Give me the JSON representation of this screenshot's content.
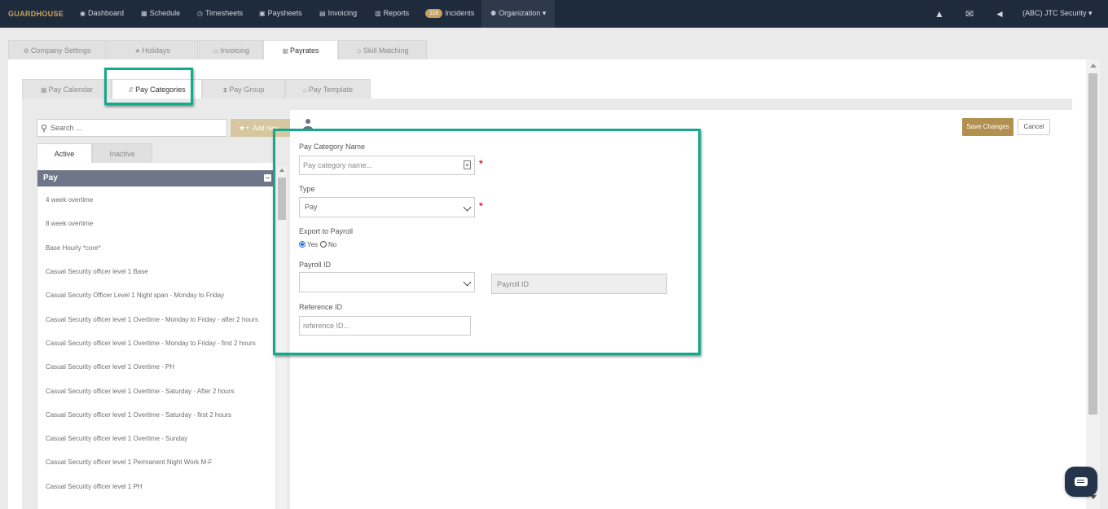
{
  "topnav": {
    "logo": "GUARDHOUSE",
    "items": [
      {
        "label": "Dashboard",
        "icon": "dashboard-icon",
        "glyph": "◉"
      },
      {
        "label": "Schedule",
        "icon": "calendar-icon",
        "glyph": "▦"
      },
      {
        "label": "Timesheets",
        "icon": "clock-icon",
        "glyph": "◷"
      },
      {
        "label": "Paysheets",
        "icon": "money-icon",
        "glyph": "▣"
      },
      {
        "label": "Invoicing",
        "icon": "invoice-icon",
        "glyph": "▤"
      },
      {
        "label": "Reports",
        "icon": "table-icon",
        "glyph": "▥"
      },
      {
        "label": "Incidents",
        "badge": "118"
      },
      {
        "label": "Organization",
        "icon": "users-icon",
        "glyph": "⚉",
        "caret": "▾"
      }
    ],
    "account": "(ABC) JTC Security",
    "account_caret": "▾",
    "right_icons": [
      {
        "name": "graduation-cap-icon",
        "glyph": "▲"
      },
      {
        "name": "envelope-icon",
        "glyph": "✉"
      },
      {
        "name": "megaphone-icon",
        "glyph": "◄"
      }
    ]
  },
  "top_tabs": [
    {
      "label": "Company Settings",
      "icon": "gear-icon",
      "glyph": "⚙"
    },
    {
      "label": "Holidays",
      "icon": "star-icon",
      "glyph": "★"
    },
    {
      "label": "Invoicing",
      "icon": "invoice-icon",
      "glyph": "▭"
    },
    {
      "label": "Payrates",
      "icon": "calendar-icon",
      "glyph": "▦",
      "active": true
    },
    {
      "label": "Skill Matching",
      "icon": "diamond-icon",
      "glyph": "◇"
    }
  ],
  "sub_tabs": [
    {
      "label": "Pay Calendar",
      "icon": "calendar-icon",
      "glyph": "▦"
    },
    {
      "label": "Pay Categories",
      "icon": "sort-icon",
      "glyph": "⇵",
      "active": true
    },
    {
      "label": "Pay Group",
      "icon": "hourglass-icon",
      "glyph": "⧗"
    },
    {
      "label": "Pay Template",
      "icon": "bank-icon",
      "glyph": "⌂"
    }
  ],
  "left": {
    "search_placeholder": "Search ...",
    "add_new_label": "Add new",
    "status_tabs": {
      "active": "Active",
      "inactive": "Inactive"
    },
    "group_title": "Pay",
    "items": [
      "4 week overtime",
      "8 week overtime",
      "Base Hourly *core*",
      "Casual Security officer level 1 Base",
      "Casual Security Officer Level 1 Night span - Monday to Friday",
      "Casual Security officer level 1 Overtime - Monday to Friday - after 2 hours",
      "Casual Security officer level 1 Overtime - Monday to Friday - first 2 hours",
      "Casual Security officer level 1 Overtime - PH",
      "Casual Security officer level 1 Overtime - Saturday - After 2 hours",
      "Casual Security officer level 1 Overtime - Saturday - first 2 hours",
      "Casual Security officer level 1 Overtime - Sunday",
      "Casual Security officer level 1 Permanent Night Work M-F",
      "Casual Security officer level 1 PH"
    ]
  },
  "form": {
    "save_label": "Save Changes",
    "cancel_label": "Cancel",
    "name_label": "Pay Category Name",
    "name_placeholder": "Pay category name...",
    "type_label": "Type",
    "type_value": "Pay",
    "export_label": "Export to Payroll",
    "export_yes": "Yes",
    "export_no": "No",
    "export_selected": "Yes",
    "payroll_id_label": "Payroll ID",
    "payroll_id_select_value": "",
    "payroll_id_placeholder": "Payroll ID",
    "reference_label": "Reference ID",
    "reference_placeholder": "reference ID...",
    "required_mark": "*"
  },
  "colors": {
    "nav_bg": "#1e2b3c",
    "accent_gold": "#b2904f",
    "highlight_teal": "#14a98a",
    "group_header": "#6f7689"
  }
}
